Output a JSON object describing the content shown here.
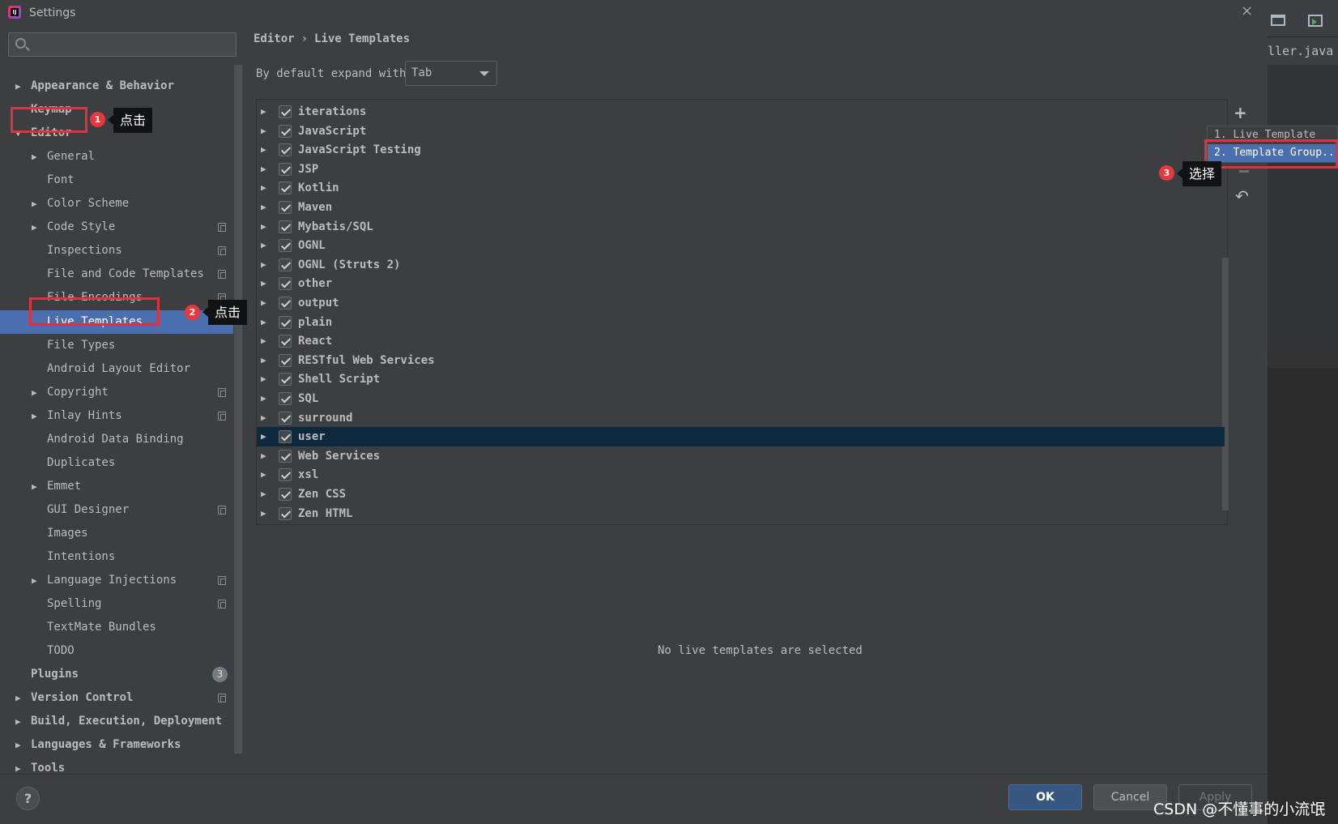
{
  "window": {
    "title": "Settings",
    "close": "×"
  },
  "right_strip": {
    "tab_label": "ller.java",
    "tab_close": "×"
  },
  "search": {
    "placeholder": ""
  },
  "sidebar": {
    "items": [
      {
        "label": "Appearance & Behavior",
        "expandable": true,
        "arrow": "▶"
      },
      {
        "label": "Keymap"
      },
      {
        "label": "Editor",
        "arrow": "▼"
      },
      {
        "label": "General",
        "arrow": "▶"
      },
      {
        "label": "Font"
      },
      {
        "label": "Color Scheme",
        "arrow": "▶"
      },
      {
        "label": "Code Style",
        "arrow": "▶"
      },
      {
        "label": "Inspections"
      },
      {
        "label": "File and Code Templates"
      },
      {
        "label": "File Encodings"
      },
      {
        "label": "Live Templates"
      },
      {
        "label": "File Types"
      },
      {
        "label": "Android Layout Editor"
      },
      {
        "label": "Copyright",
        "arrow": "▶"
      },
      {
        "label": "Inlay Hints",
        "arrow": "▶"
      },
      {
        "label": "Android Data Binding"
      },
      {
        "label": "Duplicates"
      },
      {
        "label": "Emmet",
        "arrow": "▶"
      },
      {
        "label": "GUI Designer"
      },
      {
        "label": "Images"
      },
      {
        "label": "Intentions"
      },
      {
        "label": "Language Injections",
        "arrow": "▶"
      },
      {
        "label": "Spelling"
      },
      {
        "label": "TextMate Bundles"
      },
      {
        "label": "TODO"
      },
      {
        "label": "Plugins",
        "badge": "3"
      },
      {
        "label": "Version Control",
        "arrow": "▶"
      },
      {
        "label": "Build, Execution, Deployment",
        "arrow": "▶"
      },
      {
        "label": "Languages & Frameworks",
        "arrow": "▶"
      },
      {
        "label": "Tools",
        "arrow": "▶"
      }
    ]
  },
  "annotations": {
    "n1": "1",
    "t1": "点击",
    "n2": "2",
    "t2": "点击",
    "n3": "3",
    "t3": "选择"
  },
  "breadcrumb": {
    "parent": "Editor",
    "separator": "›",
    "current": "Live Templates"
  },
  "expand": {
    "label": "By default expand with",
    "value": "Tab"
  },
  "template_groups": [
    "iterations",
    "JavaScript",
    "JavaScript Testing",
    "JSP",
    "Kotlin",
    "Maven",
    "Mybatis/SQL",
    "OGNL",
    "OGNL (Struts 2)",
    "other",
    "output",
    "plain",
    "React",
    "RESTful Web Services",
    "Shell Script",
    "SQL",
    "surround",
    "user",
    "Web Services",
    "xsl",
    "Zen CSS",
    "Zen HTML"
  ],
  "tree_arrow": "▶",
  "selected_group": "user",
  "toolbar": {
    "add": "+",
    "undo": "↶"
  },
  "popup": {
    "item1": "1. Live Template",
    "item2": "2. Template Group..."
  },
  "empty_message": "No live templates are selected",
  "footer": {
    "help": "?",
    "ok": "OK",
    "cancel": "Cancel",
    "apply": "Apply"
  },
  "watermark": "CSDN @不懂事的小流氓",
  "colors": {
    "accent": "#4b6eaf",
    "selection_row": "#0d293e",
    "highlight": "#e0323e",
    "ok_button": "#365880"
  }
}
